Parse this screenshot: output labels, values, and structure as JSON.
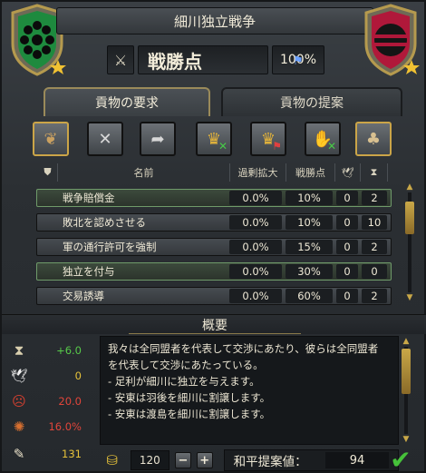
{
  "window": {
    "title": "細川独立戦争"
  },
  "war_score": {
    "label": "戦勝点",
    "value": "100%"
  },
  "tabs": [
    {
      "label": "貢物の要求",
      "active": true
    },
    {
      "label": "貢物の提案",
      "active": false
    }
  ],
  "demand_buttons": [
    {
      "icon": "cede-province-icon",
      "active": true
    },
    {
      "icon": "release-icon",
      "active": false
    },
    {
      "icon": "return-icon",
      "active": false
    },
    {
      "icon": "crown-cancel-icon",
      "active": false
    },
    {
      "icon": "crown-flag-icon",
      "active": false
    },
    {
      "icon": "hand-cancel-icon",
      "active": false
    },
    {
      "icon": "humiliate-icon",
      "active": true
    }
  ],
  "table": {
    "columns": [
      "名前",
      "過剰拡大",
      "戦勝点"
    ],
    "rows": [
      {
        "name": "戦争賠償金",
        "over": "0.0%",
        "ws": "10%",
        "a": "0",
        "b": "2",
        "selected": true
      },
      {
        "name": "敗北を認めさせる",
        "over": "0.0%",
        "ws": "10%",
        "a": "0",
        "b": "10",
        "selected": false
      },
      {
        "name": "軍の通行許可を強制",
        "over": "0.0%",
        "ws": "15%",
        "a": "0",
        "b": "2",
        "selected": false
      },
      {
        "name": "独立を付与",
        "over": "0.0%",
        "ws": "30%",
        "a": "0",
        "b": "0",
        "selected": true
      },
      {
        "name": "交易誘導",
        "over": "0.0%",
        "ws": "60%",
        "a": "0",
        "b": "2",
        "selected": false
      }
    ]
  },
  "summary": {
    "title": "概要",
    "stats": [
      {
        "icon": "hourglass-icon",
        "value": "+6.0",
        "color": "#57c94a"
      },
      {
        "icon": "dove-icon",
        "value": "0",
        "color": "#e6c23a"
      },
      {
        "icon": "angry-face-icon",
        "value": "20.0",
        "color": "#e0453a"
      },
      {
        "icon": "map-unrest-icon",
        "value": "16.0%",
        "color": "#e0453a"
      },
      {
        "icon": "quill-paper-icon",
        "value": "131",
        "color": "#e6c23a"
      }
    ],
    "description_lines": [
      "我々は全同盟者を代表して交渉にあたり、彼らは全同盟者",
      "を代表して交渉にあたっている。",
      "",
      "- 足利が細川に独立を与えます。",
      "- 安東は羽後を細川に割譲します。",
      "- 安東は渡島を細川に割譲します。"
    ]
  },
  "bottom": {
    "gold": "120",
    "minus": "−",
    "plus": "+",
    "peace_label": "和平提案値：",
    "peace_value": "94"
  },
  "colors": {
    "gold": "#c9a848",
    "green": "#46c23a"
  }
}
